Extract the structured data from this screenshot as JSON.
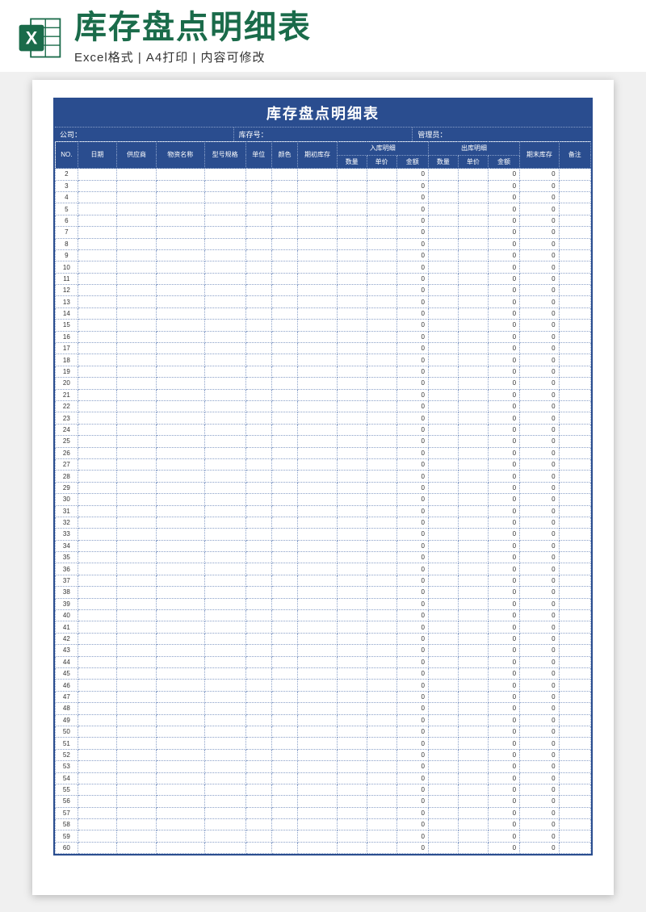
{
  "header": {
    "title": "库存盘点明细表",
    "subtitle": "Excel格式  |  A4打印  |  内容可修改"
  },
  "sheet": {
    "title": "库存盘点明细表",
    "info": {
      "company_label": "公司：",
      "stock_no_label": "库存号：",
      "manager_label": "管理员："
    },
    "columns": {
      "no": "NO.",
      "date": "日期",
      "supplier": "供应商",
      "material": "物资名称",
      "spec": "型号规格",
      "unit": "单位",
      "color": "颜色",
      "initial": "期初库存",
      "in_group": "入库明细",
      "out_group": "出库明细",
      "qty": "数量",
      "price": "单价",
      "amount": "金额",
      "ending": "期末库存",
      "note": "备注"
    },
    "row_start": 2,
    "row_end": 60,
    "default_amount": "0"
  }
}
